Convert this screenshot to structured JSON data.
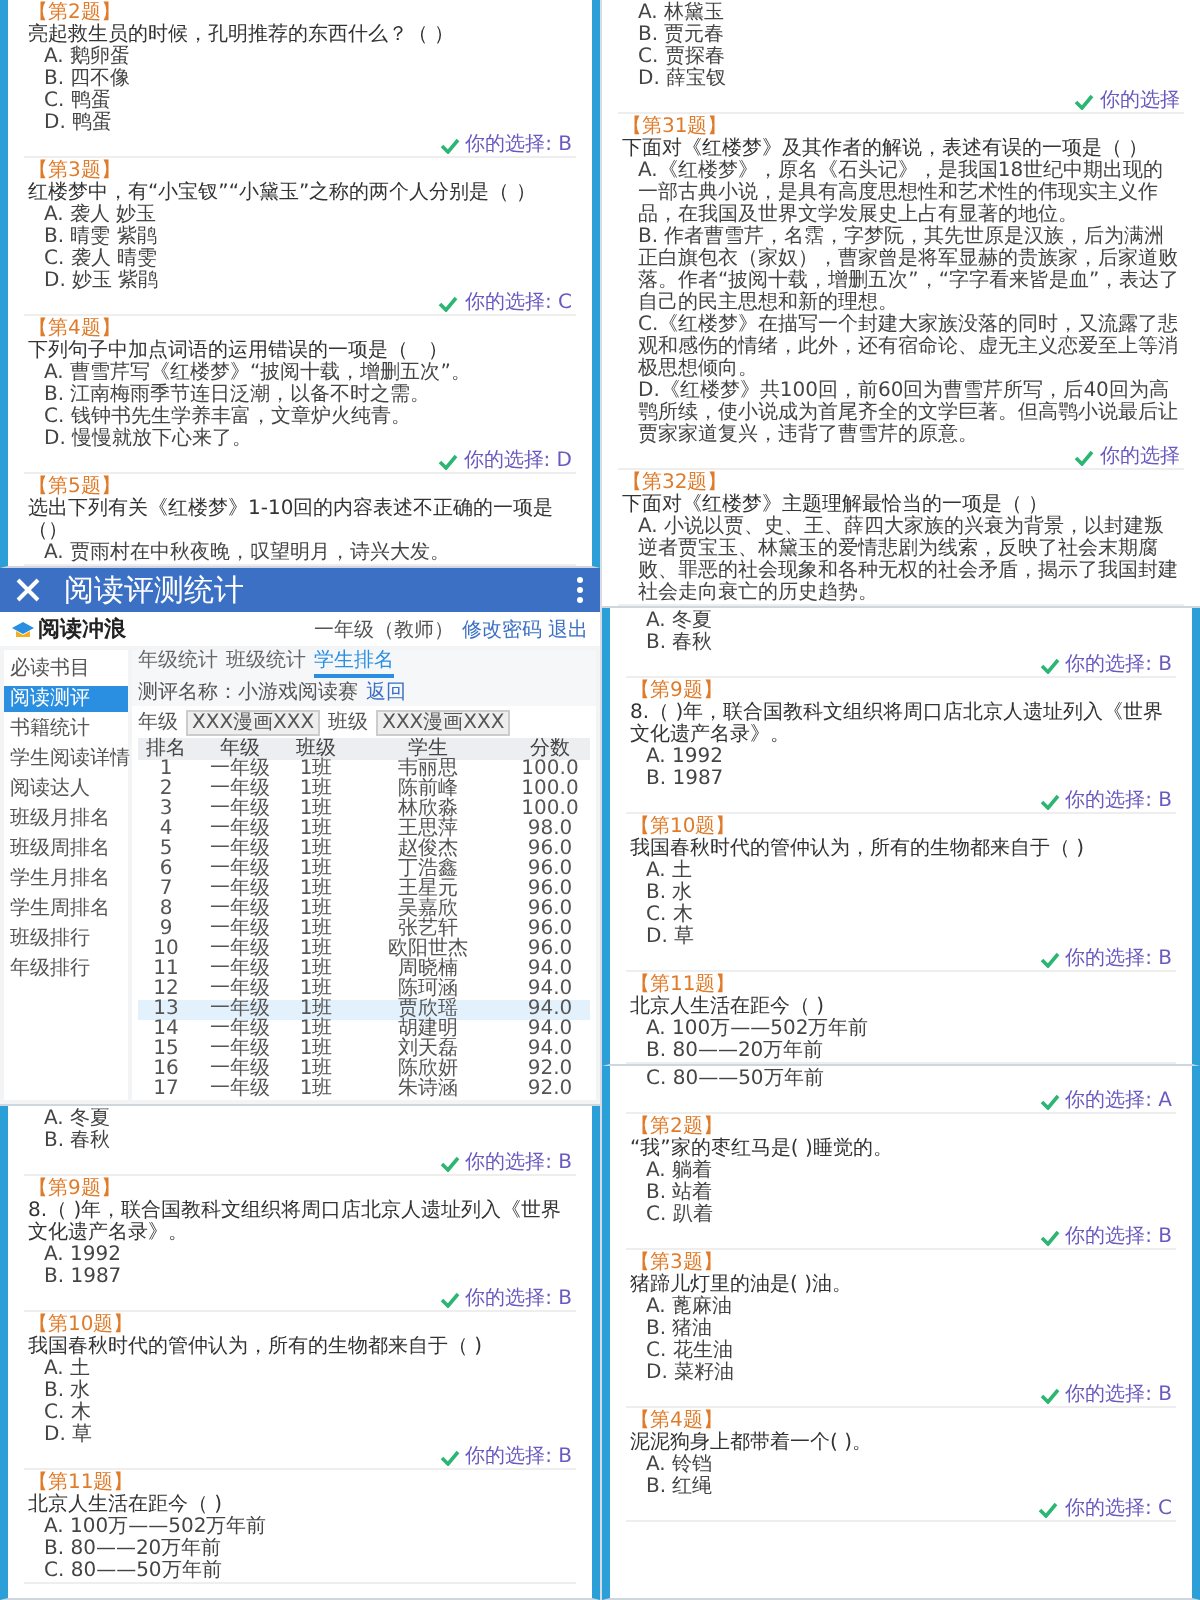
{
  "columns": [
    {
      "sections": [
        {
          "kind": "quiz",
          "bordered": true,
          "items": [
            {
              "label": "【第2题】",
              "question": "亮起救生员的时候，孔明推荐的东西什么？（ ）",
              "options": [
                "A. 鹅卵蛋",
                "B. 四不像",
                "C. 鸭蛋",
                "D. 鸭蛋"
              ],
              "answer": "你的选择: B"
            },
            {
              "label": "【第3题】",
              "question": "红楼梦中，有“小宝钗”“小黛玉”之称的两个人分别是（ ）",
              "options": [
                "A. 袭人 妙玉",
                "B. 晴雯 紫鹃",
                "C. 袭人 晴雯",
                "D. 妙玉 紫鹃"
              ],
              "answer": "你的选择: C"
            },
            {
              "label": "【第4题】",
              "question": "下列句子中加点词语的运用错误的一项是（　）",
              "options": [
                "A. 曹雪芹写《红楼梦》“披阅十载，增删五次”。",
                "B. 江南梅雨季节连日泛潮，以备不时之需。",
                "C. 钱钟书先生学养丰富，文章炉火纯青。",
                "D. 慢慢就放下心来了。"
              ],
              "answer": "你的选择: D"
            },
            {
              "label": "【第5题】",
              "question": "选出下列有关《红楼梦》1-10回的内容表述不正确的一项是（）",
              "options": [
                "A. 贾雨村在中秋夜晚，叹望明月，诗兴大发。"
              ]
            }
          ]
        },
        {
          "kind": "stats",
          "title": "阅读评测统计",
          "brand": "阅读冲浪",
          "user": "一年级（教师）",
          "logout": "修改密码 退出",
          "sidebar": [
            {
              "label": "必读书目",
              "selected": false
            },
            {
              "label": "阅读测评",
              "selected": true
            },
            {
              "label": "书籍统计",
              "selected": false
            },
            {
              "label": "学生阅读详情",
              "selected": false
            },
            {
              "label": "阅读达人",
              "selected": false
            },
            {
              "label": "班级月排名",
              "selected": false
            },
            {
              "label": "班级周排名",
              "selected": false
            },
            {
              "label": "学生月排名",
              "selected": false
            },
            {
              "label": "学生周排名",
              "selected": false
            },
            {
              "label": "班级排行",
              "selected": false
            },
            {
              "label": "年级排行",
              "selected": false
            }
          ],
          "tabs": [
            {
              "label": "年级统计",
              "selected": false
            },
            {
              "label": "班级统计",
              "selected": false
            },
            {
              "label": "学生排名",
              "selected": true
            }
          ],
          "test_name": "测评名称：小游戏阅读赛",
          "back": "返回",
          "filters": [
            {
              "label": "年级",
              "value": "XXX漫画XXX"
            },
            {
              "label": "班级",
              "value": "XXX漫画XXX"
            }
          ],
          "columns": [
            "排名",
            "年级",
            "班级",
            "学生",
            "分数"
          ],
          "rows": [
            {
              "cells": [
                "1",
                "一年级",
                "1班",
                "韦丽思",
                "100.0"
              ],
              "selected": false
            },
            {
              "cells": [
                "2",
                "一年级",
                "1班",
                "陈前峰",
                "100.0"
              ],
              "selected": false
            },
            {
              "cells": [
                "3",
                "一年级",
                "1班",
                "林欣淼",
                "100.0"
              ],
              "selected": false
            },
            {
              "cells": [
                "4",
                "一年级",
                "1班",
                "王思萍",
                "98.0"
              ],
              "selected": false
            },
            {
              "cells": [
                "5",
                "一年级",
                "1班",
                "赵俊杰",
                "96.0"
              ],
              "selected": false
            },
            {
              "cells": [
                "6",
                "一年级",
                "1班",
                "丁浩鑫",
                "96.0"
              ],
              "selected": false
            },
            {
              "cells": [
                "7",
                "一年级",
                "1班",
                "王星元",
                "96.0"
              ],
              "selected": false
            },
            {
              "cells": [
                "8",
                "一年级",
                "1班",
                "吴嘉欣",
                "96.0"
              ],
              "selected": false
            },
            {
              "cells": [
                "9",
                "一年级",
                "1班",
                "张艺轩",
                "96.0"
              ],
              "selected": false
            },
            {
              "cells": [
                "10",
                "一年级",
                "1班",
                "欧阳世杰",
                "96.0"
              ],
              "selected": false
            },
            {
              "cells": [
                "11",
                "一年级",
                "1班",
                "周晓楠",
                "94.0"
              ],
              "selected": false
            },
            {
              "cells": [
                "12",
                "一年级",
                "1班",
                "陈珂涵",
                "94.0"
              ],
              "selected": false
            },
            {
              "cells": [
                "13",
                "一年级",
                "1班",
                "贾欣瑶",
                "94.0"
              ],
              "selected": true
            },
            {
              "cells": [
                "14",
                "一年级",
                "1班",
                "胡建明",
                "94.0"
              ],
              "selected": false
            },
            {
              "cells": [
                "15",
                "一年级",
                "1班",
                "刘天磊",
                "94.0"
              ],
              "selected": false
            },
            {
              "cells": [
                "16",
                "一年级",
                "1班",
                "陈欣妍",
                "92.0"
              ],
              "selected": false
            },
            {
              "cells": [
                "17",
                "一年级",
                "1班",
                "朱诗涵",
                "92.0"
              ],
              "selected": false
            }
          ]
        },
        {
          "kind": "quiz",
          "bordered": true,
          "items": [
            {
              "options": [
                "A. 冬夏",
                "B. 春秋"
              ],
              "answer": "你的选择: B"
            },
            {
              "label": "【第9题】",
              "question": "8.（ )年，联合国教科文组织将周口店北京人遗址列入《世界文化遗产名录》。",
              "options": [
                "A. 1992",
                "B. 1987"
              ],
              "answer": "你的选择: B"
            },
            {
              "label": "【第10题】",
              "question": "我国春秋时代的管仲认为，所有的生物都来自于（ )",
              "options": [
                "A. 土",
                "B. 水",
                "C. 木",
                "D. 草"
              ],
              "answer": "你的选择: B"
            },
            {
              "label": "【第11题】",
              "question": "北京人生活在距今（ )",
              "options": [
                "A. 100万——502万年前",
                "B. 80——20万年前",
                "C. 80——50万年前"
              ]
            }
          ]
        }
      ]
    },
    {
      "sections": [
        {
          "kind": "quiz",
          "bordered": false,
          "items": [
            {
              "options": [
                "A. 林黛玉",
                "B. 贾元春",
                "C. 贾探春",
                "D. 薛宝钗"
              ],
              "answer": "你的选择"
            },
            {
              "label": "【第31题】",
              "question": "下面对《红楼梦》及其作者的解说，表述有误的一项是（ ）",
              "options": [
                "A.《红楼梦》，原名《石头记》，是我国18世纪中期出现的一部古典小说，是具有高度思想性和艺术性的伟现实主义作品，在我国及世界文学发展史上占有显著的地位。",
                "B. 作者曹雪芹，名霑，字梦阮，其先世原是汉族，后为满洲正白旗包衣（家奴），曹家曾是将军显赫的贵族家，后家道败落。作者“披阅十载，增删五次”，“字字看来皆是血”，表达了自己的民主思想和新的理想。",
                "C.《红楼梦》在描写一个封建大家族没落的同时，又流露了悲观和感伤的情绪，此外，还有宿命论、虚无主义恋爱至上等消极思想倾向。",
                "D.《红楼梦》共100回，前60回为曹雪芹所写，后40回为高鹗所续，使小说成为首尾齐全的文学巨著。但高鹗小说最后让贾家家道复兴，违背了曹雪芹的原意。"
              ],
              "answer": "你的选择"
            },
            {
              "label": "【第32题】",
              "question": "下面对《红楼梦》主题理解最恰当的一项是（ ）",
              "options": [
                "A. 小说以贾、史、王、薛四大家族的兴衰为背景，以封建叛逆者贾宝玉、林黛玉的爱情悲剧为线索，反映了社会末期腐败、罪恶的社会现象和各种无权的社会矛盾，揭示了我国封建社会走向衰亡的历史趋势。"
              ]
            }
          ]
        },
        {
          "kind": "quiz",
          "bordered": true,
          "items": [
            {
              "options": [
                "A. 冬夏",
                "B. 春秋"
              ],
              "answer": "你的选择: B"
            },
            {
              "label": "【第9题】",
              "question": "8.（ )年，联合国教科文组织将周口店北京人遗址列入《世界文化遗产名录》。",
              "options": [
                "A. 1992",
                "B. 1987"
              ],
              "answer": "你的选择: B"
            },
            {
              "label": "【第10题】",
              "question": "我国春秋时代的管仲认为，所有的生物都来自于（ )",
              "options": [
                "A. 土",
                "B. 水",
                "C. 木",
                "D. 草"
              ],
              "answer": "你的选择: B"
            },
            {
              "label": "【第11题】",
              "question": "北京人生活在距今（ )",
              "options": [
                "A. 100万——502万年前",
                "B. 80——20万年前"
              ]
            }
          ]
        },
        {
          "kind": "quiz",
          "bordered": true,
          "items": [
            {
              "options": [
                "C. 80——50万年前"
              ],
              "answer": "你的选择: A"
            },
            {
              "label": "【第2题】",
              "question": "“我”家的枣红马是( )睡觉的。",
              "options": [
                "A. 躺着",
                "B. 站着",
                "C. 趴着"
              ],
              "answer": "你的选择: B"
            },
            {
              "label": "【第3题】",
              "question": "猪蹄儿灯里的油是( )油。",
              "options": [
                "A. 蓖麻油",
                "B. 猪油",
                "C. 花生油",
                "D. 菜籽油"
              ],
              "answer": "你的选择: B"
            },
            {
              "label": "【第4题】",
              "question": "泥泥狗身上都带着一个( )。",
              "options": [
                "A. 铃铛",
                "B. 红绳"
              ],
              "answer": "你的选择: C"
            }
          ]
        }
      ]
    }
  ]
}
